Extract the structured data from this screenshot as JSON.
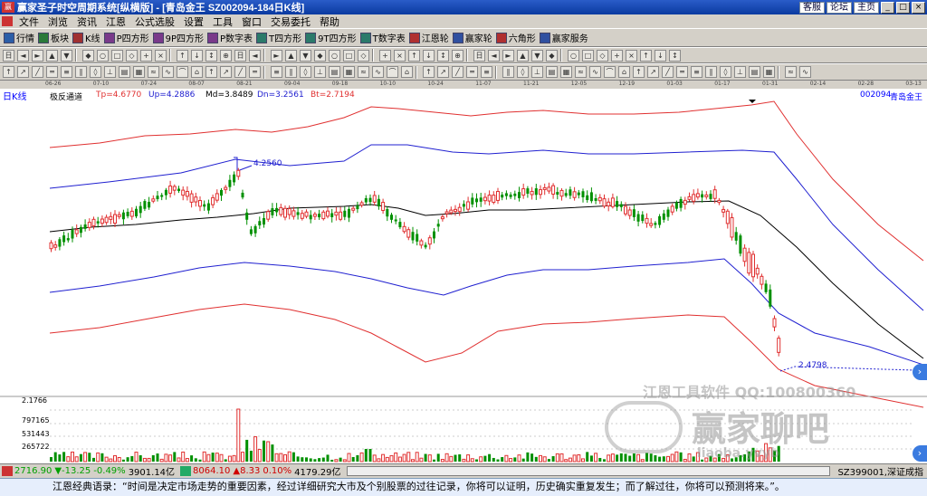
{
  "window": {
    "title": "赢家圣子时空周期系统[纵横版] - [青岛金王   SZ002094-184日K线]",
    "links": [
      "客服",
      "论坛",
      "主页"
    ],
    "buttons": [
      "_",
      "□",
      "×"
    ]
  },
  "menu": [
    "文件",
    "浏览",
    "资讯",
    "江恩",
    "公式选股",
    "设置",
    "工具",
    "窗口",
    "交易委托",
    "帮助"
  ],
  "toolbar1": [
    {
      "label": "行情",
      "icon": "grid-icon",
      "color": "#2b5ea8"
    },
    {
      "label": "板块",
      "icon": "blocks-icon",
      "color": "#2b7a3a"
    },
    {
      "label": "K线",
      "icon": "candle-icon",
      "color": "#a03030"
    },
    {
      "label": "P四方形",
      "icon": "square-p-icon",
      "color": "#7a3a8a"
    },
    {
      "label": "9P四方形",
      "icon": "square-9p-icon",
      "color": "#7a3a8a"
    },
    {
      "label": "P数字表",
      "icon": "table-p-icon",
      "color": "#7a3a8a"
    },
    {
      "label": "T四方形",
      "icon": "square-t-icon",
      "color": "#2b7a6a"
    },
    {
      "label": "9T四方形",
      "icon": "square-9t-icon",
      "color": "#2b7a6a"
    },
    {
      "label": "T数字表",
      "icon": "table-t-icon",
      "color": "#2b7a6a"
    },
    {
      "label": "江恩轮",
      "icon": "wheel-icon",
      "color": "#b03030"
    },
    {
      "label": "赢家轮",
      "icon": "wheel2-icon",
      "color": "#3050a0"
    },
    {
      "label": "六角形",
      "icon": "hexagon-icon",
      "color": "#b03030"
    },
    {
      "label": "赢家服务",
      "icon": "service-icon",
      "color": "#3050a0"
    }
  ],
  "header": {
    "panel_label": "日K线",
    "indicator_name": "极反通道",
    "indicators": [
      "Tp=4.6770",
      "Up=4.2886",
      "Md=3.8489",
      "Dn=3.2561",
      "Bt=2.7194"
    ],
    "code": "002094",
    "name": "青岛金王"
  },
  "dates": [
    "06-26",
    "07-10",
    "07-24",
    "08-07",
    "08-21",
    "09-04",
    "09-18",
    "10-10",
    "10-24",
    "11-07",
    "11-21",
    "12-05",
    "12-19",
    "01-03",
    "01-17",
    "01-31",
    "02-14",
    "02-28",
    "03-13"
  ],
  "chart_data": {
    "type": "candlestick",
    "title": "",
    "price_annotations": [
      "4.2560",
      "2.4798"
    ],
    "volume_ticks": [
      "2.1766",
      "797165",
      "531443",
      "265722"
    ],
    "channels": {
      "Tp": "#e03030",
      "Up": "#2020d0",
      "Md": "#000000",
      "Dn": "#2020d0",
      "Bt": "#e03030"
    }
  },
  "watermark": {
    "line1": "江恩工具软件  QQ:100800360",
    "line2": "赢家聊吧",
    "line3": "liaoba.yvyb"
  },
  "status": {
    "sh_index": "2716.90",
    "sh_change": "▼-13.25",
    "sh_pct": "-0.49%",
    "sh_amount": "3901.14亿",
    "sz_index": "8064.10",
    "sz_change": "▲8.33",
    "sz_pct": "0.10%",
    "sz_amount": "4179.29亿",
    "right_text": "SZ399001,深证成指"
  },
  "quote": "江恩经典语录：“时间是决定市场走势的重要因素，经过详细研究大市及个别股票的过往记录，你将可以证明，历史确实重复发生；而了解过往，你将可以预测将来。”。"
}
